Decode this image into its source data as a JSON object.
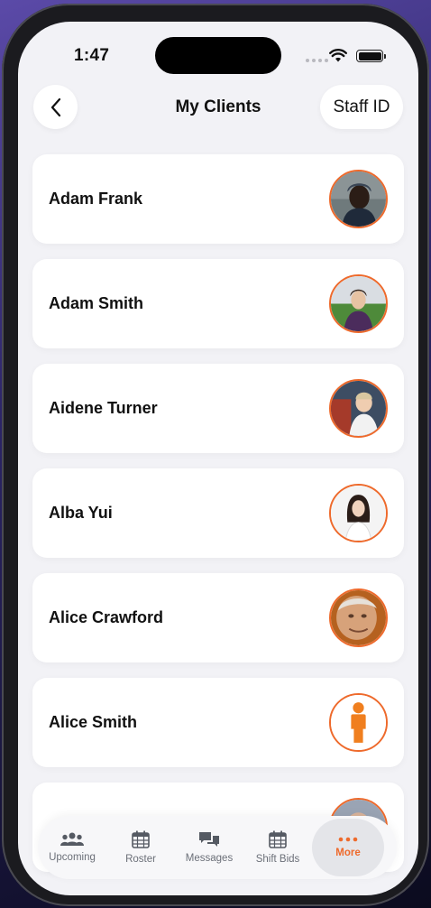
{
  "status": {
    "time": "1:47"
  },
  "header": {
    "title": "My Clients",
    "staff_label": "Staff ID"
  },
  "clients": [
    {
      "name": "Adam Frank"
    },
    {
      "name": "Adam Smith"
    },
    {
      "name": "Aidene Turner"
    },
    {
      "name": "Alba Yui"
    },
    {
      "name": "Alice Crawford"
    },
    {
      "name": "Alice Smith"
    },
    {
      "name": ""
    }
  ],
  "tabs": [
    {
      "label": "Upcoming",
      "icon": "people-icon"
    },
    {
      "label": "Roster",
      "icon": "calendar-icon"
    },
    {
      "label": "Messages",
      "icon": "chat-bubbles-icon"
    },
    {
      "label": "Shift Bids",
      "icon": "calendar-grid-icon"
    },
    {
      "label": "More",
      "icon": "ellipsis-icon",
      "active": true
    }
  ],
  "colors": {
    "accent": "#ee6a2c",
    "background": "#f2f2f6",
    "card": "#ffffff"
  }
}
